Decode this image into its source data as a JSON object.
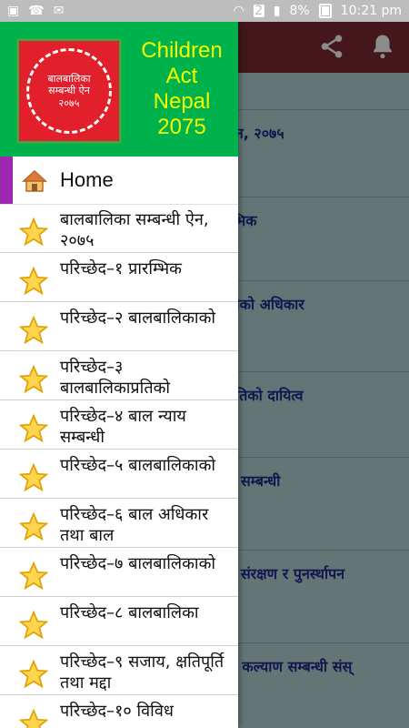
{
  "status_bar": {
    "sim_slot": "2",
    "battery": "8%",
    "time": "10:21 pm"
  },
  "drawer": {
    "header_title_lines": [
      "Children",
      "Act",
      "Nepal",
      "2075"
    ],
    "logo_text_lines": [
      "बालबालिका",
      "सम्बन्धी ऐन",
      "२०७५"
    ],
    "home_label": "Home",
    "items": [
      {
        "label": "बालबालिका सम्बन्धी ऐन, २०७५"
      },
      {
        "label": "परिच्छेद–१ प्रारम्भिक"
      },
      {
        "label": "परिच्छेद–२ बालबालिकाको"
      },
      {
        "label": "परिच्छेद–३ बालबालिकाप्रतिको"
      },
      {
        "label": "परिच्छेद–४ बाल न्याय सम्बन्धी"
      },
      {
        "label": "परिच्छेद–५ बालबालिकाको"
      },
      {
        "label": "परिच्छेद–६ बाल अधिकार तथा बाल"
      },
      {
        "label": "परिच्छेद–७ बालबालिकाको"
      },
      {
        "label": "परिच्छेद–८ बालबालिका"
      },
      {
        "label": "परिच्छेद–९ सजाय, क्षतिपूर्ति तथा मद्दा"
      },
      {
        "label": "परिच्छेद–१० विविध"
      }
    ]
  },
  "content": {
    "items": [
      {
        "label": "ऐन, २०७५"
      },
      {
        "label": "म्भिक"
      },
      {
        "label": "ाको अधिकार"
      },
      {
        "label": "प्रतिको दायित्व"
      },
      {
        "label": "य सम्बन्धी"
      },
      {
        "label": "ष संरक्षण र पुनर्स्थापन"
      },
      {
        "label": "ल कल्याण सम्बन्धी संस्"
      }
    ]
  },
  "icons": {
    "home": "home-icon",
    "star": "star-icon",
    "share": "share-icon",
    "bell": "bell-icon"
  },
  "colors": {
    "app_bar": "#7a2b33",
    "drawer_header": "#00b24c",
    "header_title": "#f3ff00",
    "home_accent": "#9c27b0",
    "content_bg": "#b7d6d8",
    "content_text": "#1f2b8f"
  }
}
